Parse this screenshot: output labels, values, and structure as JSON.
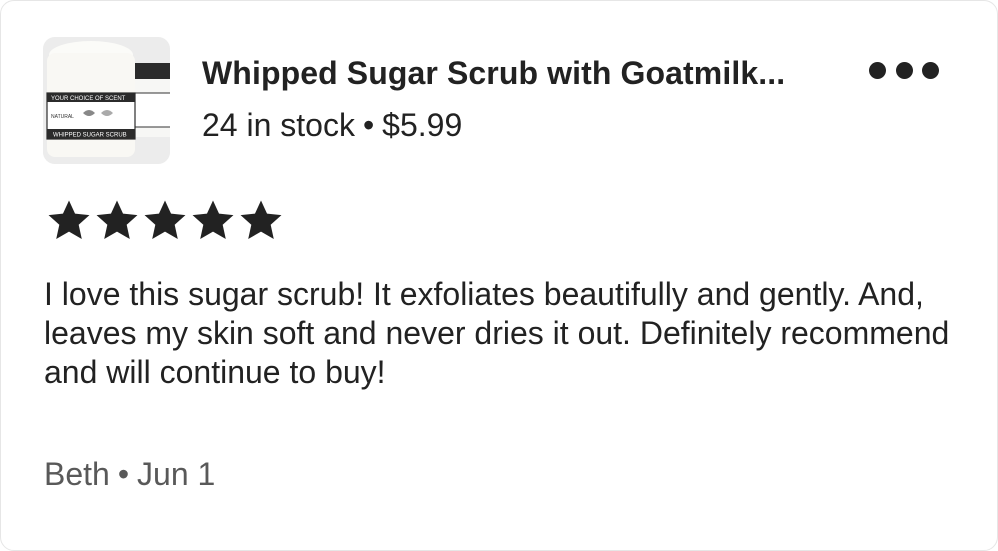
{
  "listing": {
    "title": "Whipped Sugar Scrub with Goatmilk...",
    "stock": "24 in stock",
    "separator": "•",
    "price": "$5.99",
    "image_label_top": "YOUR CHOICE OF SCENT",
    "image_label_natural": "NATURAL",
    "image_label_bottom": "WHIPPED SUGAR SCRUB"
  },
  "menu": {
    "icon": "more-horizontal-icon"
  },
  "rating": {
    "value": 5,
    "max": 5,
    "icon": "star-icon"
  },
  "review": {
    "text": "I love this sugar scrub! It exfoliates beautifully and gently. And, leaves my skin soft and never dries it out. Definitely recommend and will continue to buy!"
  },
  "reviewer": {
    "name": "Beth",
    "separator": "•",
    "date": "Jun 1"
  },
  "colors": {
    "text": "#222222",
    "muted": "#595959",
    "border": "#e6e6e6"
  }
}
